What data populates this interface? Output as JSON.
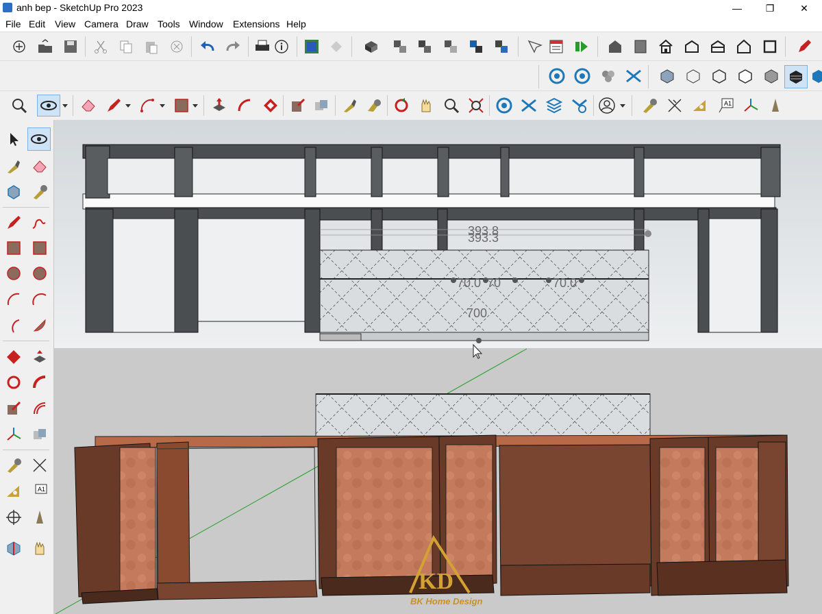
{
  "window": {
    "title": "anh bep - SketchUp Pro 2023",
    "minimize": "—",
    "maximize": "❐",
    "close": "✕"
  },
  "menu": [
    "File",
    "Edit",
    "View",
    "Camera",
    "Draw",
    "Tools",
    "Window",
    "Extensions",
    "Help"
  ],
  "toolbar_main": [
    "new-icon",
    "open-icon",
    "save-icon",
    "cut-icon",
    "copy-icon",
    "paste-icon",
    "erase-icon",
    "undo-icon",
    "redo-icon",
    "print-icon",
    "model-info-icon",
    "3d-warehouse-icon",
    "extension-warehouse-icon",
    "component-icon",
    "make-group-icon",
    "solid-tools-icon",
    "scene-icon",
    "styles-icon",
    "send-to-layout-icon",
    "add-location-icon",
    "play-icon",
    "iso-view-icon",
    "top-view-icon",
    "front-view-icon",
    "right-view-icon",
    "back-view-icon",
    "left-view-icon",
    "pencil-icon"
  ],
  "toolbar_second": [
    "section-plane-icon",
    "section-display-icon",
    "outer-shell-icon",
    "union-icon",
    "xray-icon",
    "back-edges-icon",
    "wireframe-icon",
    "hidden-line-icon",
    "shaded-icon",
    "shaded-textures-icon",
    "monochrome-icon"
  ],
  "toolbar_third": [
    "zoom-icon",
    "orbit-icon",
    "eraser-icon",
    "line-icon",
    "arc-icon",
    "rectangle-icon",
    "push-pull-icon",
    "follow-me-icon",
    "offset-icon",
    "intersect-icon",
    "scale-icon",
    "paint-bucket-icon",
    "rotate-icon",
    "pan-icon",
    "zoom-extents-icon",
    "zoom-window-icon",
    "walk-icon",
    "look-around-icon",
    "position-camera-icon",
    "profile-icon",
    "tape-measure-icon",
    "dimension-icon",
    "protractor-icon",
    "text-icon",
    "axes-icon",
    "3d-text-icon"
  ],
  "viewport": {
    "dimension_labels": [
      "393.8",
      "393.3",
      "70.0",
      "70",
      "70.0",
      "700"
    ],
    "brand": {
      "mark": "KD",
      "name": "BK Home Design"
    }
  }
}
